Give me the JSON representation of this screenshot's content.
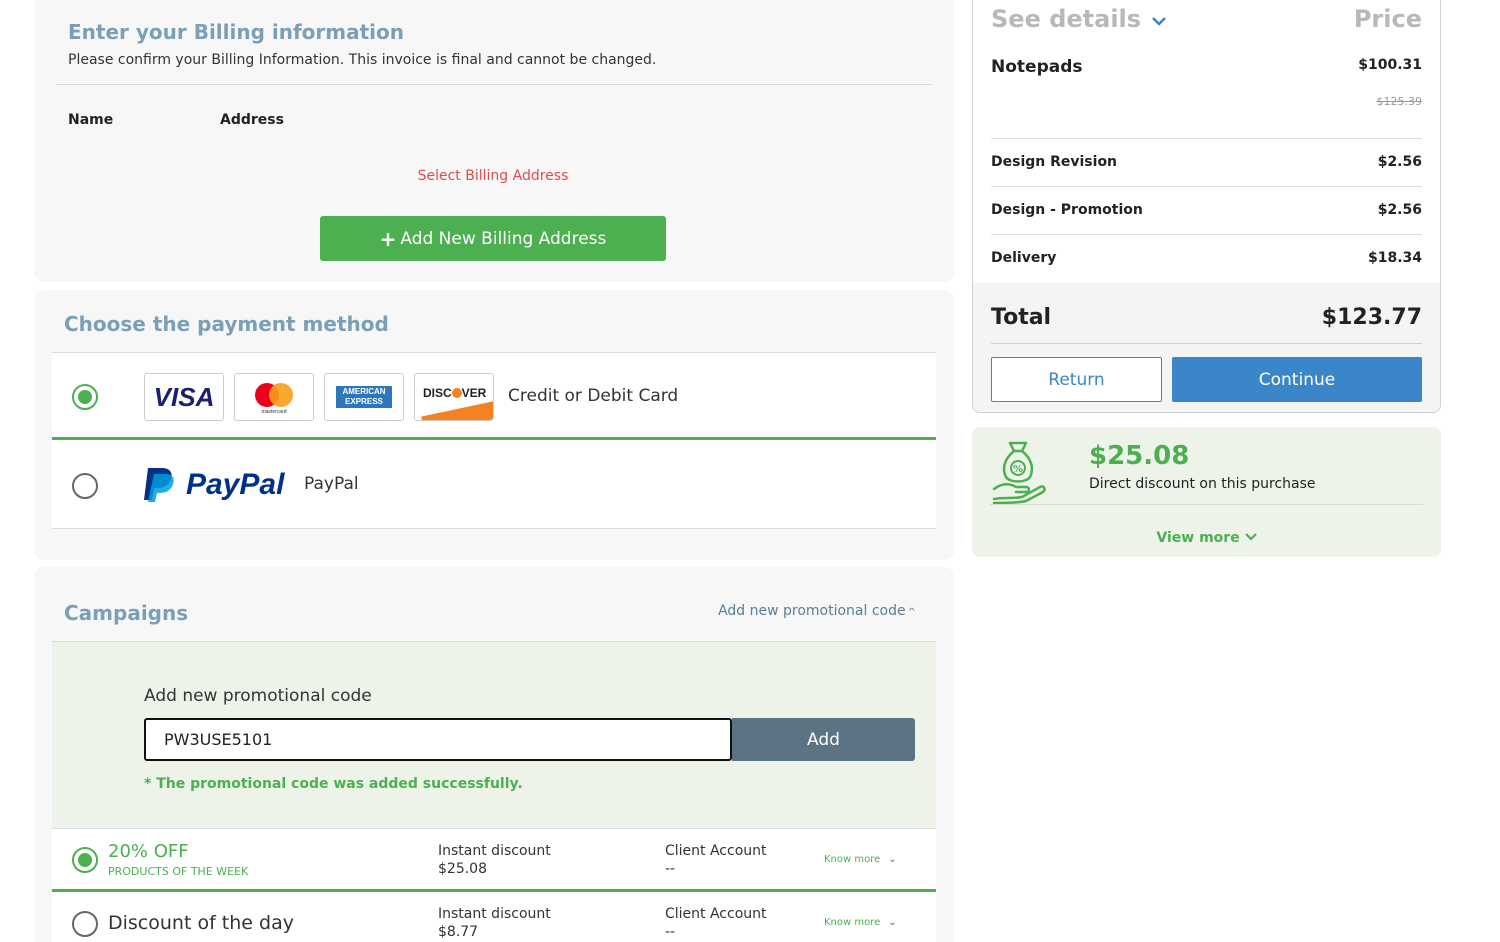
{
  "billing": {
    "title": "Enter your Billing information",
    "subtitle": "Please confirm your Billing Information. This invoice is final and cannot be changed.",
    "col_name": "Name",
    "col_address": "Address",
    "select_address": "Select Billing Address",
    "add_button_label": "Add New Billing Address"
  },
  "payment": {
    "title": "Choose the payment method",
    "options": [
      {
        "label": "Credit or Debit Card",
        "selected": true,
        "logos": [
          "VISA",
          "mastercard",
          "AMERICAN EXPRESS",
          "DISCOVER"
        ]
      },
      {
        "label": "PayPal",
        "selected": false,
        "logo": "PayPal"
      }
    ],
    "visa_text": "VISA",
    "mc_text": "mastercard",
    "amex_line1": "AMERICAN",
    "amex_line2": "EXPRESS",
    "discover_a": "DISC",
    "discover_b": "VER",
    "paypal_logo": "PayPal"
  },
  "campaigns": {
    "title": "Campaigns",
    "promo_toggle": "Add new promotional code",
    "promo_label": "Add new promotional code",
    "promo_value": "PW3USE5101",
    "promo_add": "Add",
    "promo_success": "* The promotional code was added successfully.",
    "items": [
      {
        "name": "20% OFF",
        "sub": "PRODUCTS OF THE WEEK",
        "selected": true,
        "discount_label": "Instant discount",
        "discount_value": "$25.08",
        "account_label": "Client Account",
        "account_value": "--",
        "know_more": "Know more"
      },
      {
        "name": "Discount of the day",
        "sub": "",
        "selected": false,
        "discount_label": "Instant discount",
        "discount_value": "$8.77",
        "account_label": "Client Account",
        "account_value": "--",
        "know_more": "Know more"
      }
    ]
  },
  "summary": {
    "see_details": "See details",
    "price_header": "Price",
    "items": [
      {
        "name": "Notepads",
        "price": "$100.31",
        "original_price": "$125.39"
      },
      {
        "name": "Design Revision",
        "price": "$2.56"
      },
      {
        "name": "Design - Promotion",
        "price": "$2.56"
      },
      {
        "name": "Delivery",
        "price": "$18.34"
      }
    ],
    "total_label": "Total",
    "total_value": "$123.77",
    "return_label": "Return",
    "continue_label": "Continue"
  },
  "discount": {
    "amount": "$25.08",
    "description": "Direct discount on this purchase",
    "view_more": "View more"
  },
  "colors": {
    "accent_green": "#4caf50",
    "accent_blue": "#3a86c8",
    "muted_title": "#7a9fb6",
    "error_red": "#e04c4c"
  },
  "icons": [
    "plus-icon",
    "chevron-down-icon",
    "chevron-up-icon",
    "money-bag-hand-icon",
    "radio-selected-icon",
    "radio-unselected-icon"
  ]
}
